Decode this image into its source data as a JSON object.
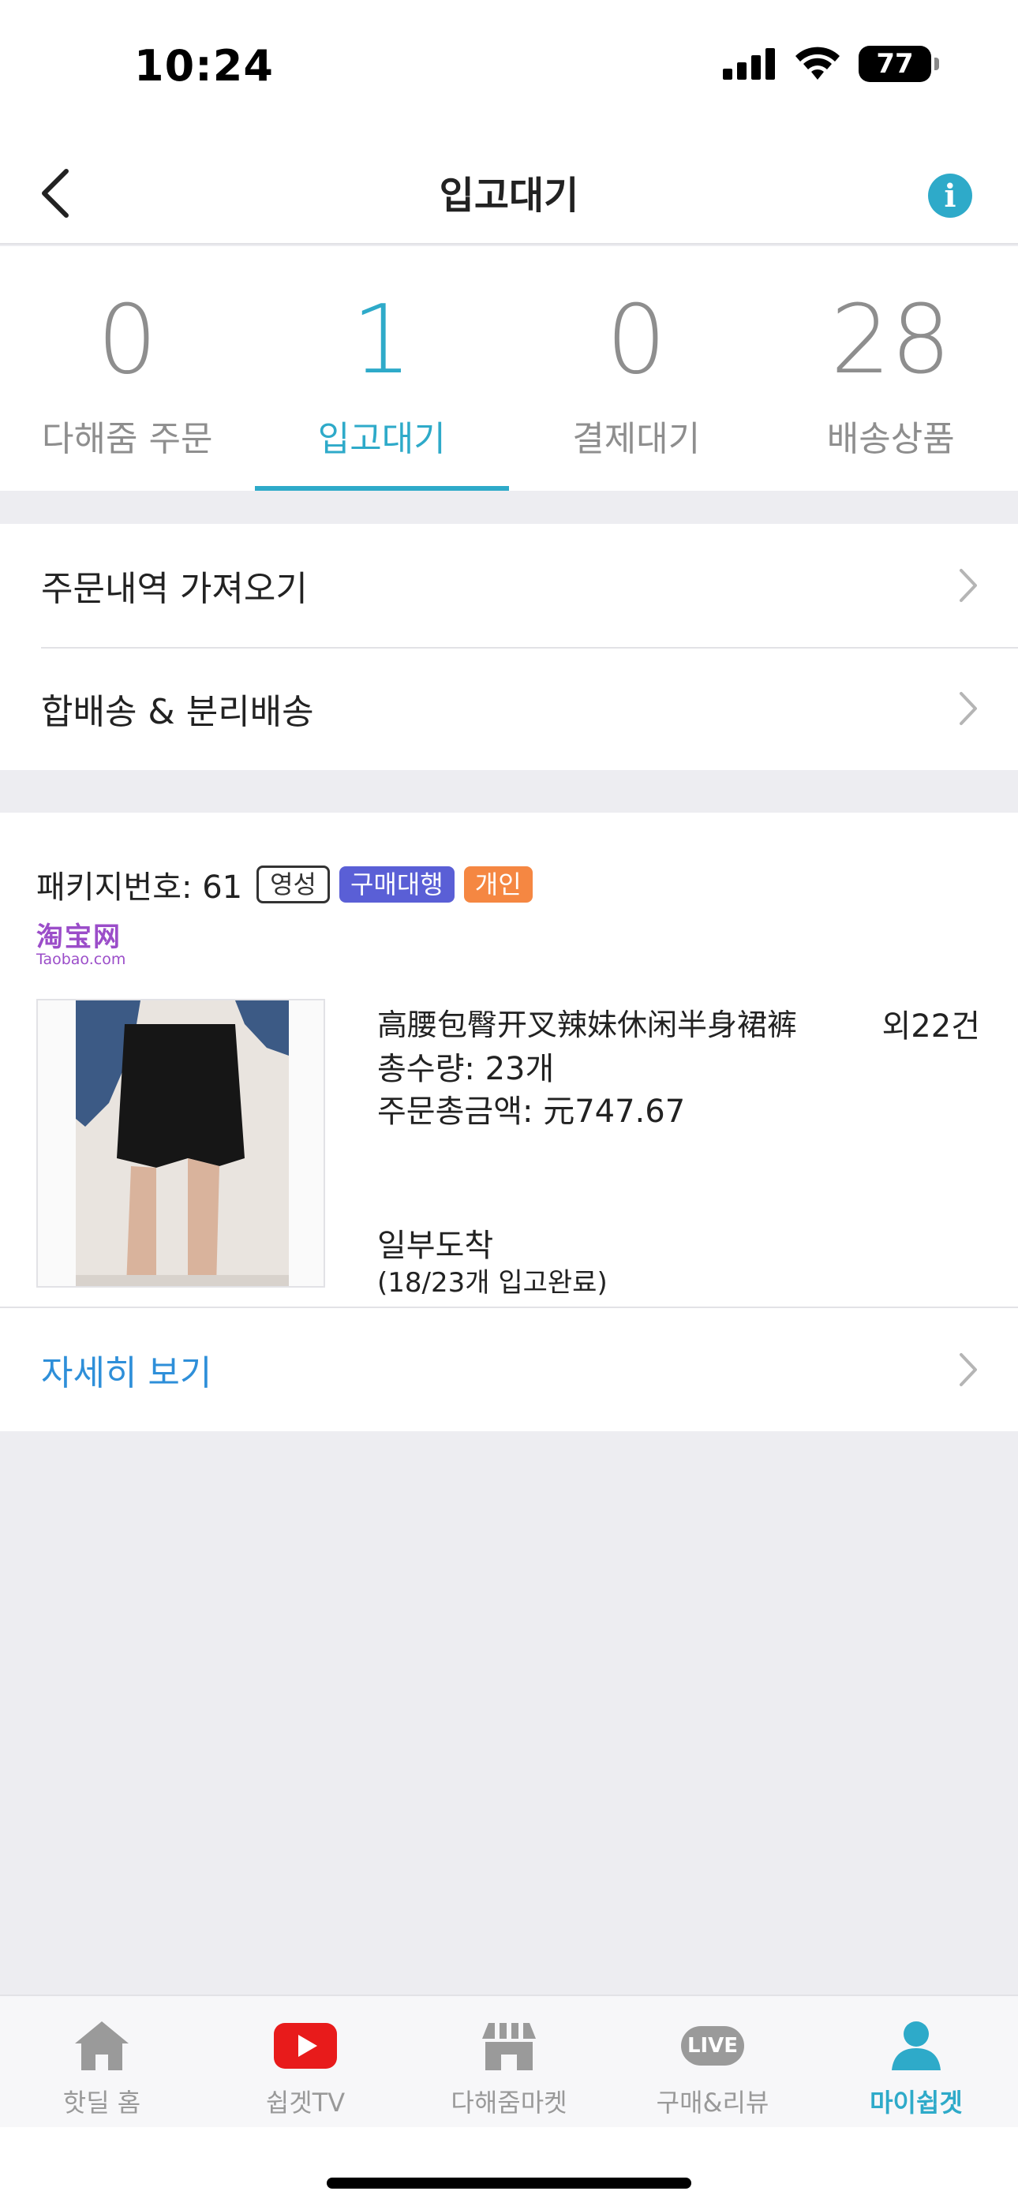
{
  "status_bar": {
    "time": "10:24",
    "battery": "77"
  },
  "nav": {
    "title": "입고대기",
    "back_icon": "chevron-left-icon",
    "info_icon": "info-icon",
    "info_glyph": "i"
  },
  "tabs": [
    {
      "count": "0",
      "label": "다해줌 주문",
      "active": false
    },
    {
      "count": "1",
      "label": "입고대기",
      "active": true
    },
    {
      "count": "0",
      "label": "결제대기",
      "active": false
    },
    {
      "count": "28",
      "label": "배송상품",
      "active": false
    }
  ],
  "menu": [
    {
      "label": "주문내역 가져오기"
    },
    {
      "label": "합배송 & 분리배송"
    }
  ],
  "package": {
    "number": "패키지번호: 61",
    "badges": [
      "영성",
      "구매대행",
      "개인"
    ],
    "source_logo_main": "淘宝网",
    "source_logo_sub": "Taobao.com",
    "product_name": "高腰包臀开叉辣妹休闲半身裙裤",
    "extra_count": "외22건",
    "quantity": "총수량: 23개",
    "total_amount": "주문총금액: 元747.67",
    "arrival_status": "일부도착",
    "arrival_detail": "(18/23개 입고완료)",
    "detail_link": "자세히 보기"
  },
  "bottom_nav": [
    {
      "label": "핫딜 홈",
      "icon": "home-icon",
      "active": false
    },
    {
      "label": "쉽겟TV",
      "icon": "youtube-icon",
      "active": false
    },
    {
      "label": "다해줌마켓",
      "icon": "store-icon",
      "active": false
    },
    {
      "label": "구매&리뷰",
      "icon": "live-icon",
      "badge": "LIVE",
      "active": false
    },
    {
      "label": "마이쉽겟",
      "icon": "person-icon",
      "active": true
    }
  ],
  "colors": {
    "accent": "#2eaac9",
    "link": "#2e8fd9",
    "badge_purple": "#5a5fd6",
    "badge_orange": "#f58742",
    "taobao": "#9b4dc9"
  }
}
